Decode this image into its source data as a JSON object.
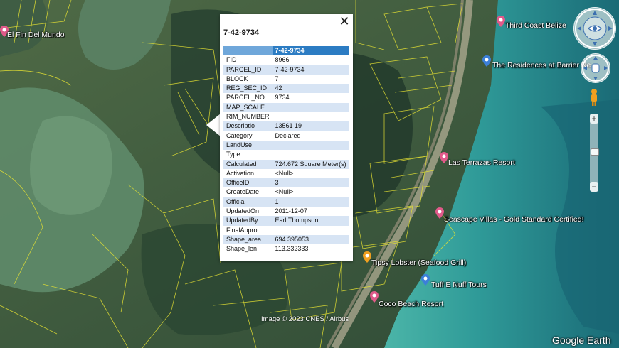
{
  "popup": {
    "title": "7-42-9734",
    "close_glyph": "✕",
    "header_value": "7-42-9734",
    "rows": [
      {
        "key": "FID",
        "value": "8966"
      },
      {
        "key": "PARCEL_ID",
        "value": "7-42-9734"
      },
      {
        "key": "BLOCK",
        "value": "7"
      },
      {
        "key": "REG_SEC_ID",
        "value": "42"
      },
      {
        "key": "PARCEL_NO",
        "value": "9734"
      },
      {
        "key": "MAP_SCALE",
        "value": ""
      },
      {
        "key": "RIM_NUMBER",
        "value": ""
      },
      {
        "key": "Descriptio",
        "value": "13561 19"
      },
      {
        "key": "Category",
        "value": "Declared"
      },
      {
        "key": "LandUse",
        "value": ""
      },
      {
        "key": "Type",
        "value": ""
      },
      {
        "key": "Calculated",
        "value": "724.672 Square Meter(s)"
      },
      {
        "key": "Activation",
        "value": "<Null>"
      },
      {
        "key": "OfficeID",
        "value": "3"
      },
      {
        "key": "CreateDate",
        "value": "<Null>"
      },
      {
        "key": "Official",
        "value": "1"
      },
      {
        "key": "UpdatedOn",
        "value": "2011-12-07"
      },
      {
        "key": "UpdatedBy",
        "value": "Earl Thompson"
      },
      {
        "key": "FinalAppro",
        "value": ""
      },
      {
        "key": "Shape_area",
        "value": "694.395053"
      },
      {
        "key": "Shape_len",
        "value": "113.332333"
      }
    ]
  },
  "places": {
    "fin_del_mundo": "El Fin Del Mundo",
    "third_coast": "Third Coast Belize",
    "residences": "The Residences at Barrier Re",
    "las_terrazas": "Las Terrazas Resort",
    "seascape": "Seascape Villas - Gold Standard Certified!",
    "tipsy_lobster": "Tipsy Lobster (Seafood Grill)",
    "tuff_e_nuff": "Tuff E Nuff Tours",
    "coco_beach": "Coco Beach Resort"
  },
  "credit": "Image © 2023 CNES / Airbus",
  "logo": "Google Earth",
  "controls": {
    "zoom_in": "+",
    "zoom_out": "−"
  },
  "colors": {
    "parcel_lines": "#e6e233",
    "table_header": "#2c7cc3",
    "table_stripe": "#d7e4f4",
    "pin_pink": "#e05a8a",
    "pin_orange": "#f0a020",
    "pin_blue": "#3c7fd8",
    "water_shallow": "#3aa9a0",
    "water_deep": "#1b6e78"
  }
}
